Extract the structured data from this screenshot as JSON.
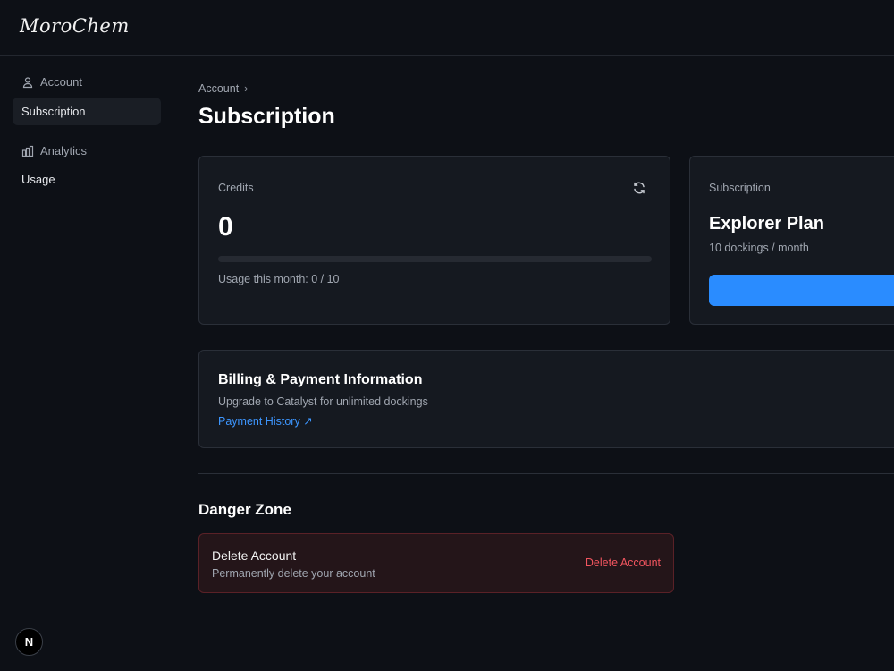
{
  "app": {
    "logo_text": "MoroChem"
  },
  "sidebar": {
    "sections": [
      {
        "label": "Account",
        "icon": "user-icon",
        "items": [
          {
            "label": "Subscription",
            "active": true
          }
        ]
      },
      {
        "label": "Analytics",
        "icon": "bar-chart-icon",
        "items": [
          {
            "label": "Usage",
            "active": false
          }
        ]
      }
    ],
    "badge_text": "N"
  },
  "breadcrumb": {
    "parent": "Account",
    "separator": "›"
  },
  "page": {
    "title": "Subscription"
  },
  "credits_card": {
    "label": "Credits",
    "value": "0",
    "usage_text": "Usage this month: 0 / 10",
    "usage_fraction": 0,
    "refresh_icon": "refresh-icon"
  },
  "subscription_card": {
    "label": "Subscription",
    "plan_name": "Explorer Plan",
    "plan_detail": "10 dockings / month"
  },
  "billing_card": {
    "title": "Billing & Payment Information",
    "subtitle": "Upgrade to Catalyst for unlimited dockings",
    "link_text": "Payment History ↗"
  },
  "danger_zone": {
    "title": "Danger Zone",
    "item_title": "Delete Account",
    "item_subtitle": "Permanently delete your account",
    "button_label": "Delete Account"
  },
  "colors": {
    "accent": "#2a8cff",
    "danger": "#f2555f",
    "background": "#0d1016"
  }
}
